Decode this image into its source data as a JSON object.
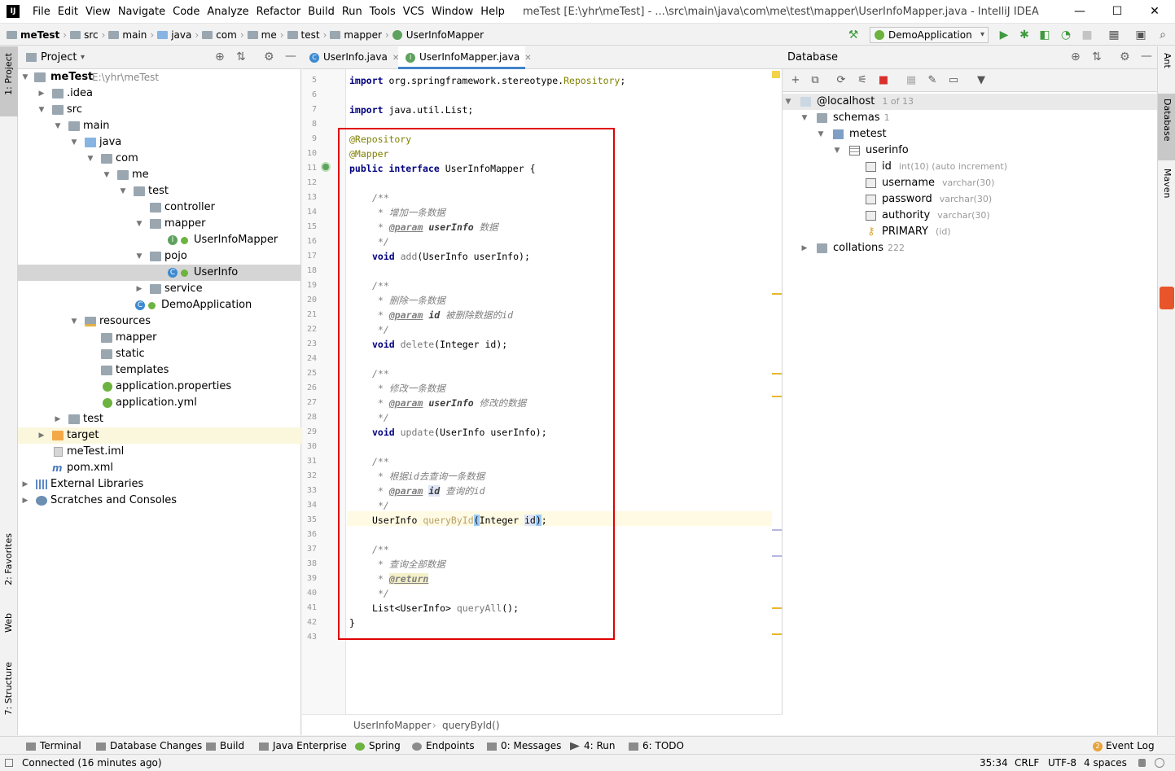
{
  "window": {
    "app_icon": "IJ",
    "title": "meTest [E:\\yhr\\meTest] - ...\\src\\main\\java\\com\\me\\test\\mapper\\UserInfoMapper.java - IntelliJ IDEA",
    "controls": {
      "minimize": "—",
      "maximize": "☐",
      "close": "✕"
    }
  },
  "menu": [
    "File",
    "Edit",
    "View",
    "Navigate",
    "Code",
    "Analyze",
    "Refactor",
    "Build",
    "Run",
    "Tools",
    "VCS",
    "Window",
    "Help"
  ],
  "breadcrumbs": [
    "meTest",
    "src",
    "main",
    "java",
    "com",
    "me",
    "test",
    "mapper",
    "UserInfoMapper"
  ],
  "run_config": "DemoApplication",
  "left_strip": {
    "project": "1: Project",
    "favorites": "2: Favorites",
    "web": "Web",
    "structure": "7: Structure"
  },
  "project_panel": {
    "title": "Project",
    "tree": [
      {
        "label": "meTest",
        "extra": "E:\\yhr\\meTest"
      },
      {
        "label": ".idea"
      },
      {
        "label": "src"
      },
      {
        "label": "main"
      },
      {
        "label": "java"
      },
      {
        "label": "com"
      },
      {
        "label": "me"
      },
      {
        "label": "test"
      },
      {
        "label": "controller"
      },
      {
        "label": "mapper"
      },
      {
        "label": "UserInfoMapper"
      },
      {
        "label": "pojo"
      },
      {
        "label": "UserInfo"
      },
      {
        "label": "service"
      },
      {
        "label": "DemoApplication"
      },
      {
        "label": "resources"
      },
      {
        "label": "mapper"
      },
      {
        "label": "static"
      },
      {
        "label": "templates"
      },
      {
        "label": "application.properties"
      },
      {
        "label": "application.yml"
      },
      {
        "label": "test"
      },
      {
        "label": "target"
      },
      {
        "label": "meTest.iml"
      },
      {
        "label": "pom.xml"
      },
      {
        "label": "External Libraries"
      },
      {
        "label": "Scratches and Consoles"
      }
    ]
  },
  "editor": {
    "tabs": [
      {
        "label": "UserInfo.java",
        "icon": "C"
      },
      {
        "label": "UserInfoMapper.java",
        "icon": "I"
      }
    ],
    "line_numbers": [
      "5",
      "6",
      "7",
      "8",
      "9",
      "10",
      "11",
      "12",
      "13",
      "14",
      "15",
      "16",
      "17",
      "18",
      "19",
      "20",
      "21",
      "22",
      "23",
      "24",
      "25",
      "26",
      "27",
      "28",
      "29",
      "30",
      "31",
      "32",
      "33",
      "34",
      "35",
      "36",
      "37",
      "38",
      "39",
      "40",
      "41",
      "42",
      "43"
    ],
    "code": {
      "l5a": "import ",
      "l5b": "org.springframework.stereotype.",
      "l5c": "Repository",
      "l5d": ";",
      "l7a": "import ",
      "l7b": "java.util.List;",
      "l9": "@Repository",
      "l10": "@Mapper",
      "l11a": "public ",
      "l11b": "interface ",
      "l11c": "UserInfoMapper {",
      "c_open": "/**",
      "c_close": "*/",
      "c_star": "* ",
      "c_param": "@param",
      "c_return": "@return",
      "l14": "增加一条数据",
      "l15p": "userInfo",
      "l15d": "数据",
      "l17a": "void ",
      "l17b": "add",
      "l17c": "(UserInfo userInfo);",
      "l20": "删除一条数据",
      "l21p": "id",
      "l21d": "被删除数据的id",
      "l23a": "void ",
      "l23b": "delete",
      "l23c": "(Integer id);",
      "l26": "修改一条数据",
      "l27p": "userInfo",
      "l27d": "修改的数据",
      "l29a": "void ",
      "l29b": "update",
      "l29c": "(UserInfo userInfo);",
      "l32": "根据id去查询一条数据",
      "l33p": "id",
      "l33d": "查询的id",
      "l35a": "UserInfo ",
      "l35b": "queryById",
      "l35c": "(",
      "l35d": "Integer ",
      "l35e": "id",
      "l35f": ")",
      "l35g": ";",
      "l38": "查询全部数据",
      "l41a": "List<UserInfo> ",
      "l41b": "queryAll",
      "l41c": "();",
      "l42": "}"
    },
    "footer": {
      "file": "UserInfoMapper",
      "sep": "›",
      "method": "queryById()"
    }
  },
  "database_panel": {
    "title": "Database",
    "tree": [
      {
        "label": "@localhost",
        "extra": "1 of 13"
      },
      {
        "label": "schemas",
        "extra": "1"
      },
      {
        "label": "metest",
        "extra": ""
      },
      {
        "label": "userinfo",
        "extra": ""
      },
      {
        "label": "id",
        "extra": "int(10) (auto increment)"
      },
      {
        "label": "username",
        "extra": "varchar(30)"
      },
      {
        "label": "password",
        "extra": "varchar(30)"
      },
      {
        "label": "authority",
        "extra": "varchar(30)"
      },
      {
        "label": "PRIMARY",
        "extra": "(id)"
      },
      {
        "label": "collations",
        "extra": "222"
      }
    ]
  },
  "right_strip": {
    "ant": "Ant",
    "database": "Database",
    "maven": "Maven"
  },
  "tool_windows": [
    "Terminal",
    "Database Changes",
    "Build",
    "Java Enterprise",
    "Spring",
    "Endpoints",
    "0: Messages",
    "4: Run",
    "6: TODO",
    "Event Log"
  ],
  "event_badge": "2",
  "status": {
    "message": "Connected (16 minutes ago)",
    "position": "35:34",
    "line_sep": "CRLF",
    "encoding": "UTF-8",
    "indent": "4 spaces"
  },
  "colors": {
    "accent": "#3d8ad0",
    "redbox": "#e00000",
    "keyword": "#000080",
    "annotation": "#808000"
  }
}
